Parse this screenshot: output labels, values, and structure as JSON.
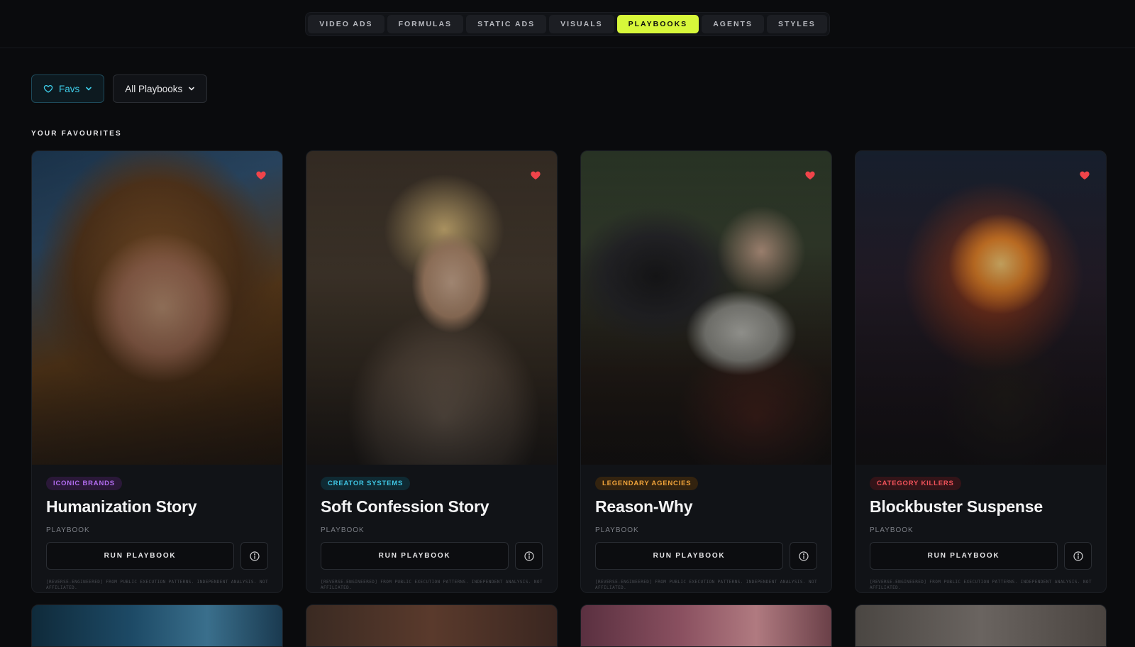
{
  "nav": {
    "tabs": [
      {
        "label": "VIDEO ADS"
      },
      {
        "label": "FORMULAS"
      },
      {
        "label": "STATIC ADS"
      },
      {
        "label": "VISUALS"
      },
      {
        "label": "PLAYBOOKS"
      },
      {
        "label": "AGENTS"
      },
      {
        "label": "STYLES"
      }
    ],
    "active": "PLAYBOOKS",
    "active_color": "#d7f73a"
  },
  "filters": {
    "favs_label": "Favs",
    "category_label": "All Playbooks"
  },
  "section": {
    "label": "YOUR FAVOURITES"
  },
  "cards": [
    {
      "tag": "ICONIC BRANDS",
      "tag_color": "#b26cf0",
      "tag_bg": "#2a1838",
      "title": "Humanization Story",
      "subtitle": "PLAYBOOK",
      "run_label": "RUN PLAYBOOK",
      "favourite": true,
      "disclaimer": "[REVERSE-ENGINEERED] FROM PUBLIC EXECUTION PATTERNS. INDEPENDENT ANALYSIS. NOT AFFILIATED."
    },
    {
      "tag": "CREATOR SYSTEMS",
      "tag_color": "#3fc6e4",
      "tag_bg": "#0f2a33",
      "title": "Soft Confession Story",
      "subtitle": "PLAYBOOK",
      "run_label": "RUN PLAYBOOK",
      "favourite": true,
      "disclaimer": "[REVERSE-ENGINEERED] FROM PUBLIC EXECUTION PATTERNS. INDEPENDENT ANALYSIS. NOT AFFILIATED."
    },
    {
      "tag": "LEGENDARY AGENCIES",
      "tag_color": "#f0a33a",
      "tag_bg": "#33230f",
      "title": "Reason-Why",
      "subtitle": "PLAYBOOK",
      "run_label": "RUN PLAYBOOK",
      "favourite": true,
      "disclaimer": "[REVERSE-ENGINEERED] FROM PUBLIC EXECUTION PATTERNS. INDEPENDENT ANALYSIS. NOT AFFILIATED."
    },
    {
      "tag": "CATEGORY KILLERS",
      "tag_color": "#f0525a",
      "tag_bg": "#331418",
      "title": "Blockbuster Suspense",
      "subtitle": "PLAYBOOK",
      "run_label": "RUN PLAYBOOK",
      "favourite": true,
      "disclaimer": "[REVERSE-ENGINEERED] FROM PUBLIC EXECUTION PATTERNS. INDEPENDENT ANALYSIS. NOT AFFILIATED."
    }
  ],
  "colors": {
    "heart": "#f0444a",
    "favs_accent": "#3fd0ec"
  },
  "icons": {
    "favs": "heart-outline-icon",
    "dropdown": "chevron-down-icon",
    "favourite": "heart-filled-icon",
    "info": "info-icon"
  }
}
